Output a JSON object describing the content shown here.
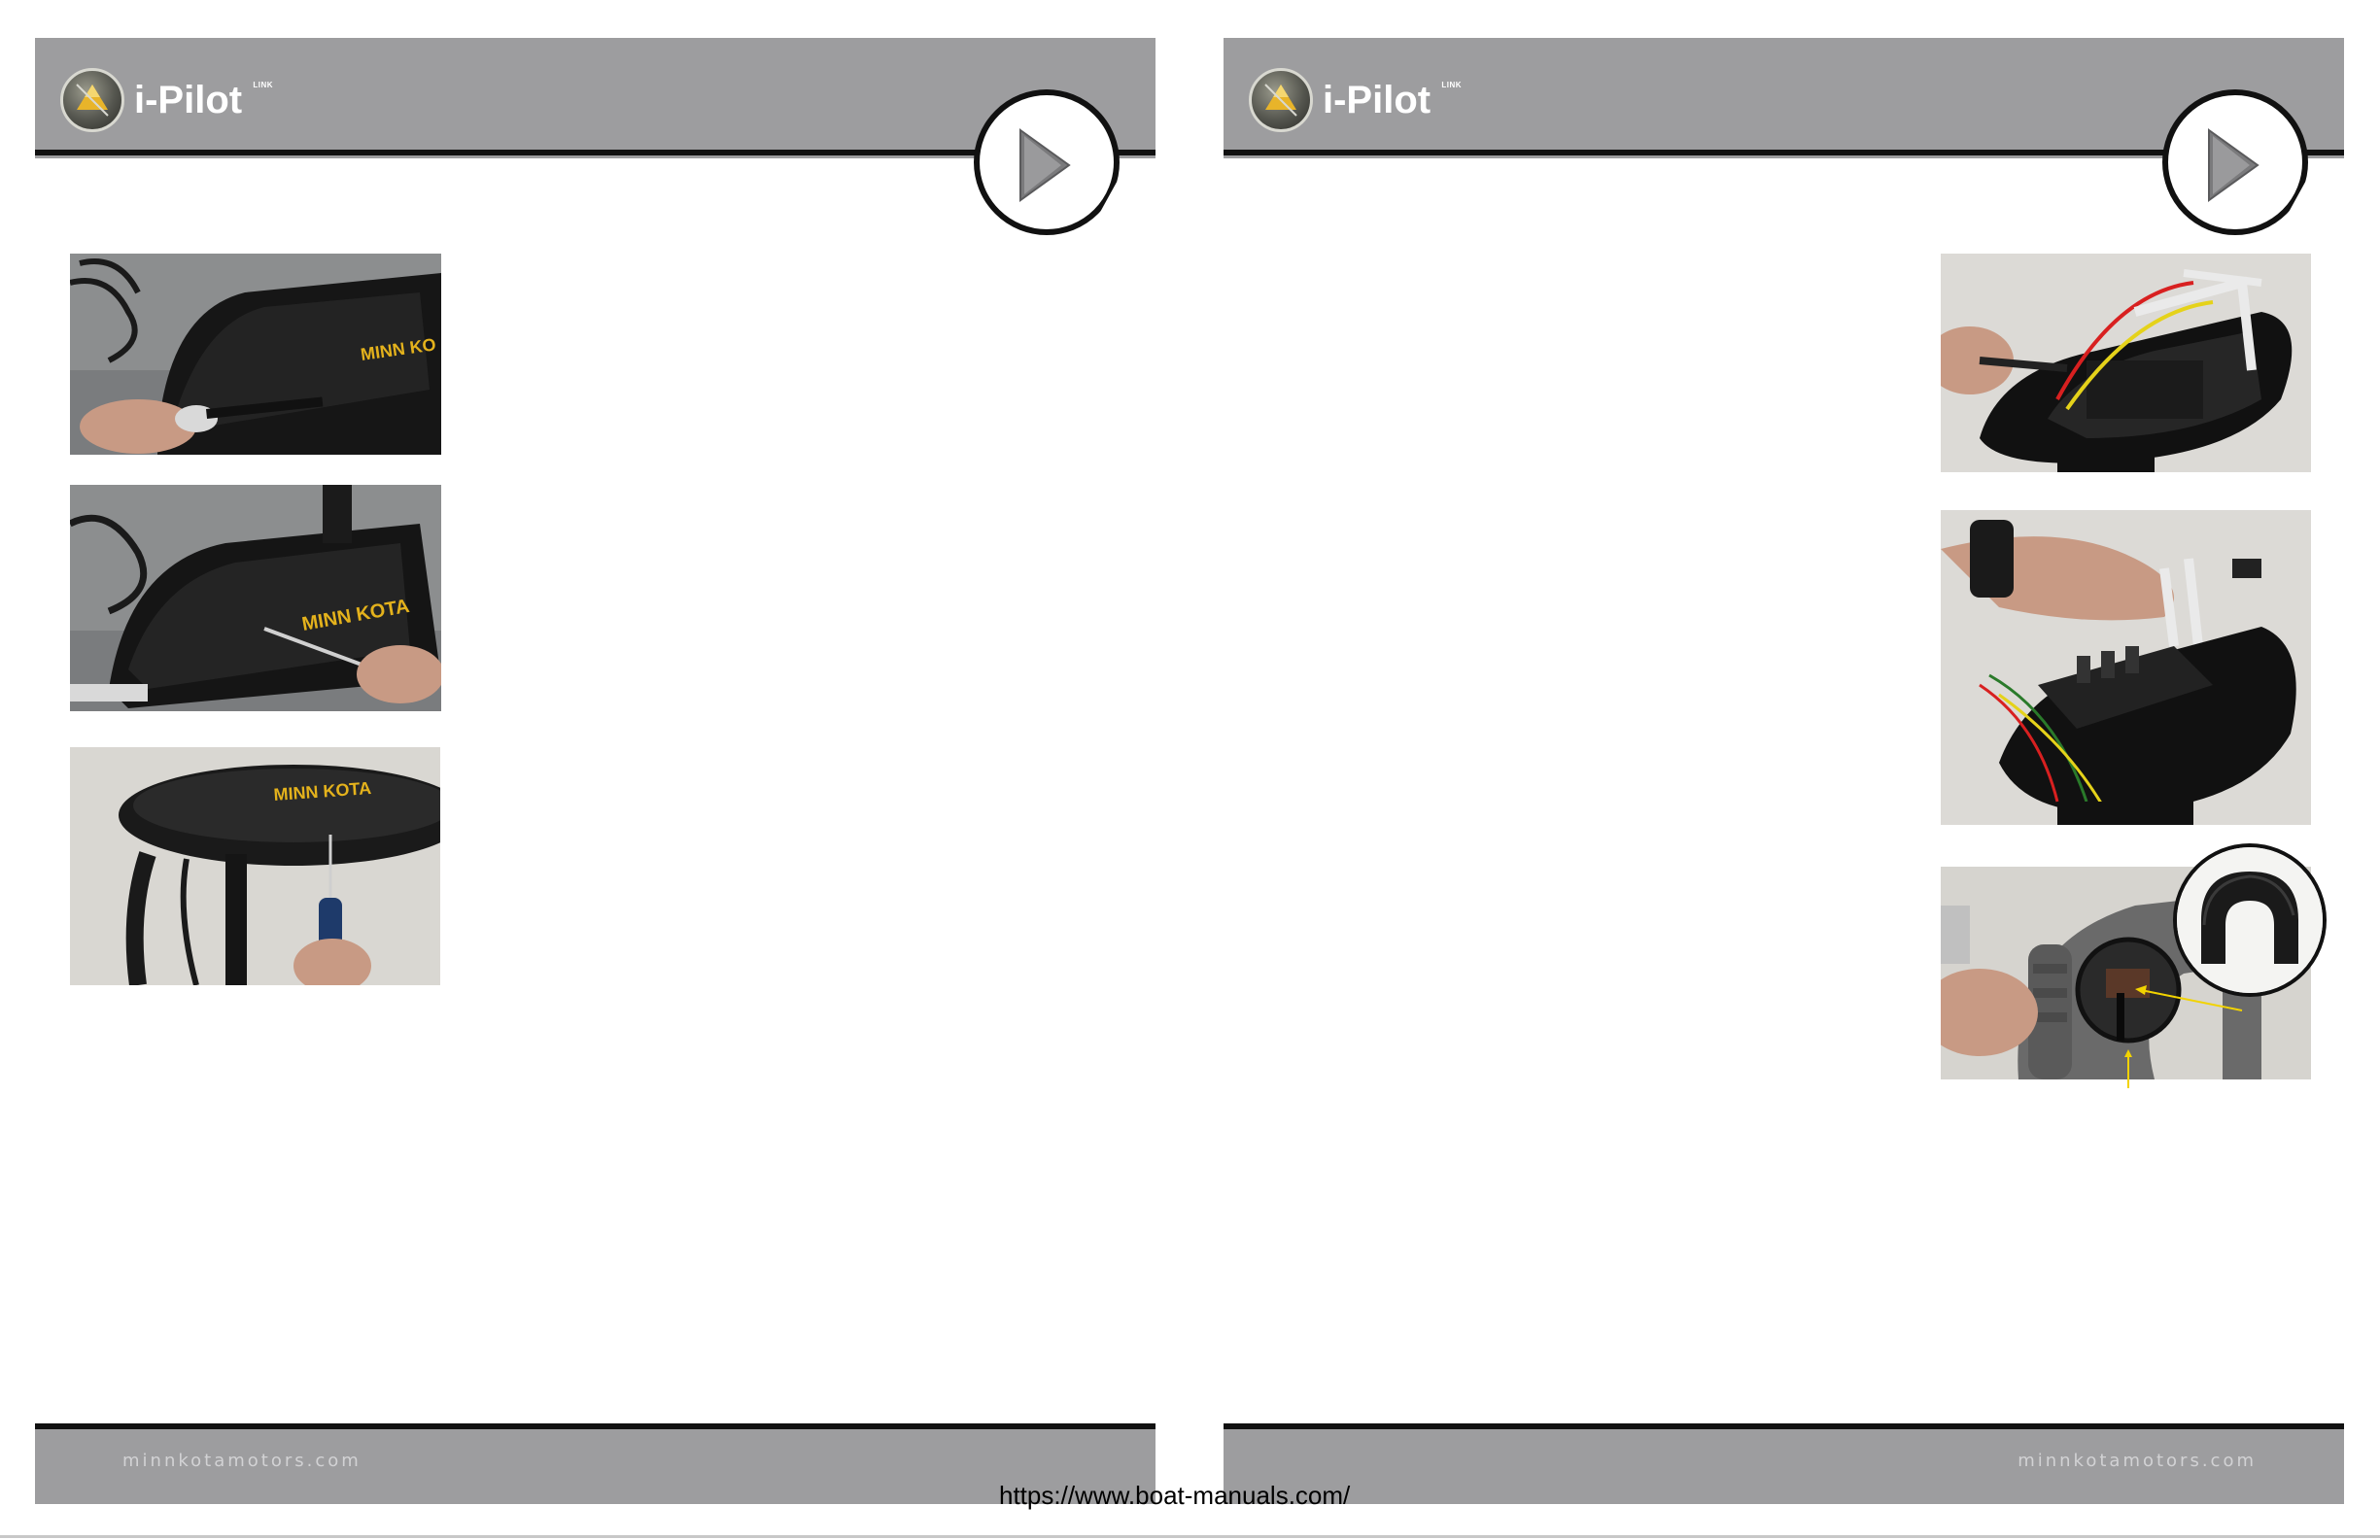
{
  "brand": {
    "logo_text": "i-Pilot",
    "logo_superscript": "LINK"
  },
  "pages": {
    "left": {
      "footer_text": "minnkotamotors.com"
    },
    "right": {
      "footer_text": "minnkotamotors.com"
    }
  },
  "icons": {
    "next": "play-arrow-icon",
    "logo": "triangle-badge-icon"
  },
  "colors": {
    "header_bg": "#9d9d9f",
    "rule": "#111111",
    "accent_yellow": "#f2d300",
    "footer_text": "#d2d2d4"
  },
  "watermark": "https://www.boat-manuals.com/"
}
